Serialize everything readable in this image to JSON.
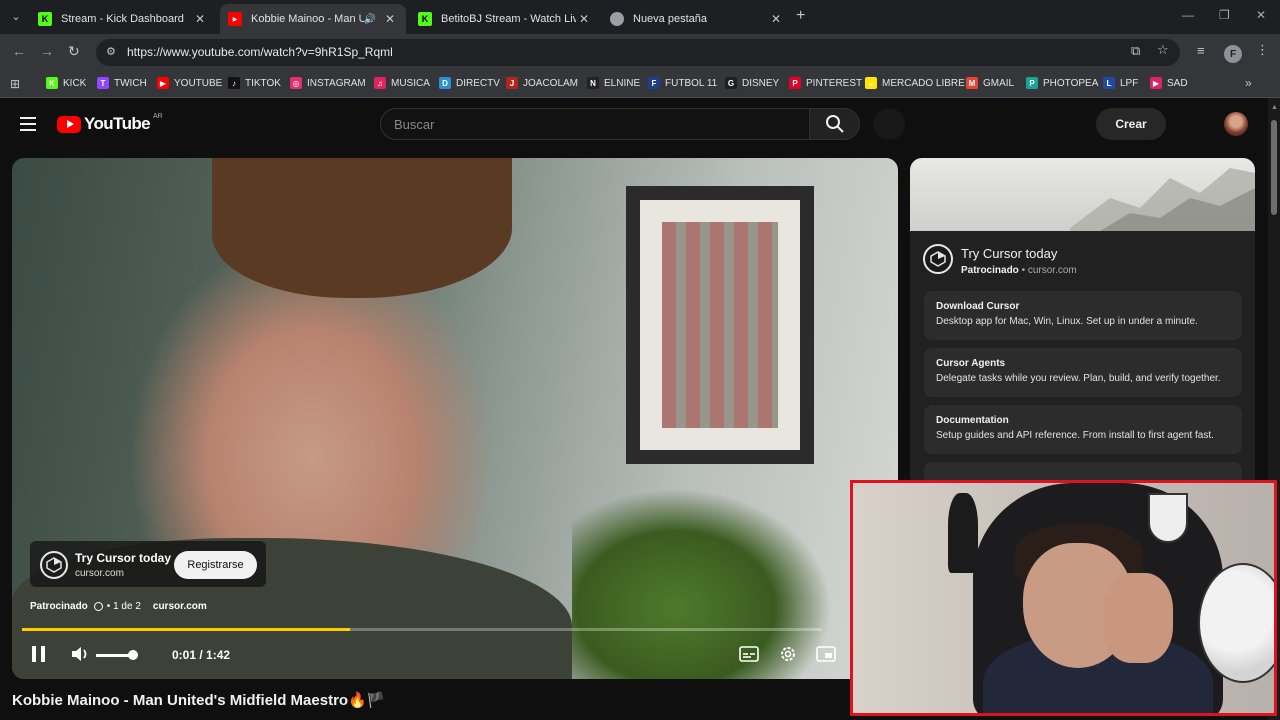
{
  "browser": {
    "tabs": [
      {
        "title": "Stream - Kick Dashboard",
        "favicon": "kick-icon",
        "color": "#53fc18",
        "active": false
      },
      {
        "title": "Kobbie Mainoo - Man United",
        "favicon": "youtube-icon",
        "color": "#ff0000",
        "active": true,
        "audio": true
      },
      {
        "title": "BetitoBJ Stream - Watch Live on",
        "favicon": "kick-icon",
        "color": "#53fc18",
        "active": false
      },
      {
        "title": "Nueva pestaña",
        "favicon": "chrome-icon",
        "color": "#9aa0a6",
        "active": false
      }
    ],
    "url": "https://www.youtube.com/watch?v=9hR1Sp_Rqml",
    "profile_initial": "F",
    "bookmarks": [
      {
        "label": "KICK",
        "icon": "kick-icon",
        "color": "#53fc18",
        "glyph": "K"
      },
      {
        "label": "TWICH",
        "icon": "twitch-icon",
        "color": "#9146ff",
        "glyph": "T"
      },
      {
        "label": "YOUTUBE",
        "icon": "youtube-icon",
        "color": "#ff0000",
        "glyph": "▶"
      },
      {
        "label": "TIKTOK",
        "icon": "tiktok-icon",
        "color": "#111111",
        "glyph": "♪"
      },
      {
        "label": "INSTAGRAM",
        "icon": "instagram-icon",
        "color": "#e1306c",
        "glyph": "◎"
      },
      {
        "label": "MUSICA",
        "icon": "music-icon",
        "color": "#e0245e",
        "glyph": "♫"
      },
      {
        "label": "DIRECTV",
        "icon": "directv-icon",
        "color": "#2d8fd5",
        "glyph": "D"
      },
      {
        "label": "JOACOLAM",
        "icon": "joacolam-icon",
        "color": "#b3261e",
        "glyph": "J"
      },
      {
        "label": "ELNINE",
        "icon": "elnine-icon",
        "color": "#222222",
        "glyph": "N"
      },
      {
        "label": "FUTBOL 11",
        "icon": "futbol-icon",
        "color": "#1d3f8a",
        "glyph": "F"
      },
      {
        "label": "DISNEY",
        "icon": "disney-icon",
        "color": "#1f1f1f",
        "glyph": "G"
      },
      {
        "label": "PINTEREST",
        "icon": "pinterest-icon",
        "color": "#e60023",
        "glyph": "P"
      },
      {
        "label": "MERCADO LIBRE",
        "icon": "mercadolibre-icon",
        "color": "#ffe600",
        "glyph": "◒"
      },
      {
        "label": "GMAIL",
        "icon": "gmail-icon",
        "color": "#ea4335",
        "glyph": "M"
      },
      {
        "label": "PHOTOPEA",
        "icon": "photopea-icon",
        "color": "#18a497",
        "glyph": "P"
      },
      {
        "label": "LPF",
        "icon": "lpf-icon",
        "color": "#1f4aa8",
        "glyph": "L"
      },
      {
        "label": "SAD",
        "icon": "sad-icon",
        "color": "#e0245e",
        "glyph": "▶"
      }
    ]
  },
  "youtube": {
    "logo_word": "YouTube",
    "country": "AR",
    "search_placeholder": "Buscar",
    "create_label": "Crear",
    "player": {
      "ad_title": "Try Cursor today",
      "ad_domain": "cursor.com",
      "ad_button": "Registrarse",
      "sponsored": "Patrocinado",
      "ad_count": "• 1 de 2",
      "ad_meta_domain": "cursor.com",
      "progress_fraction": 0.41,
      "progress_color": "#ffcc00",
      "volume_fraction": 0.85,
      "time": "0:01 / 1:42"
    },
    "video_title": "Kobbie Mainoo - Man United's Midfield Maestro🔥🏴"
  },
  "side_ad": {
    "title": "Try Cursor today",
    "sponsored": "Patrocinado",
    "domain": "• cursor.com",
    "links": [
      {
        "title": "Download Cursor",
        "desc": "Desktop app for Mac, Win, Linux. Set up in under a minute."
      },
      {
        "title": "Cursor Agents",
        "desc": "Delegate tasks while you review. Plan, build, and verify together."
      },
      {
        "title": "Documentation",
        "desc": "Setup guides and API reference. From install to first agent fast."
      }
    ]
  },
  "webcam": {
    "border_color": "#e1121d"
  }
}
